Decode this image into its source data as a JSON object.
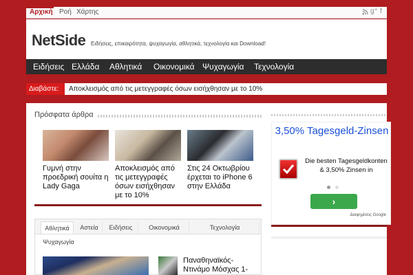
{
  "topnav": {
    "items": [
      "Αρχική",
      "Ροή",
      "Χάρτης"
    ],
    "social_icons": [
      "rss-icon",
      "google-plus-icon",
      "facebook-icon"
    ]
  },
  "header": {
    "logo": "NetSide",
    "tagline": "Ειδήσεις, επικαιρότητα, ψυχαγωγία, αθλητικά, τεχνολογία και Download!"
  },
  "mainnav": {
    "items": [
      "Ειδήσεις",
      "Ελλάδα",
      "Αθλητικά",
      "Οικονομικά",
      "Ψυχαγωγία",
      "Τεχνολογία"
    ]
  },
  "ticker": {
    "label": "Διαβάστε:",
    "text": "Αποκλεισμός από τις μετεγγραφές όσων εισήχθησαν με το 10%"
  },
  "recent": {
    "title": "Πρόσφατα άρθρα",
    "cards": [
      {
        "title": "Γυμνή στην προεδρική σουίτα η Lady Gaga"
      },
      {
        "title": "Αποκλεισμός από τις μετεγγραφές όσων εισήχθησαν με το 10%"
      },
      {
        "title": "Στις 24 Οκτωβρίου έρχεται το iPhone 6 στην Ελλάδα"
      }
    ]
  },
  "tabs": {
    "items": [
      "Αθλητικά",
      "Αστεία",
      "Ειδήσεις",
      "Οικονομικά",
      "Τεχνολογία",
      "Ψυχαγωγία"
    ],
    "active": "Αθλητικά",
    "article_title": "Παναθηναϊκός-Ντινάμο Μόσχας 1-"
  },
  "ad": {
    "title": "3,50% Tagesgeld-Zinsen",
    "text": "Die besten Tagesgeldkonten & 3,50% Zinsen in",
    "button": "›",
    "google": "Διαφημίσεις Google"
  },
  "colors": {
    "brand": "#b01c1f",
    "nav_bg": "#2d2d2d",
    "ticker_label": "#d81b1b",
    "ad_title": "#1a4fd6",
    "ad_button": "#3aa84b"
  }
}
